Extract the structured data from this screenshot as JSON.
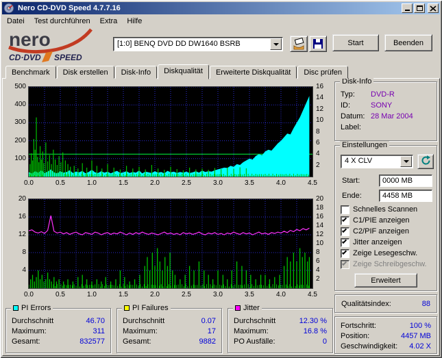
{
  "window": {
    "title": "Nero CD-DVD Speed 4.7.7.16"
  },
  "menu": {
    "items": [
      "Datei",
      "Test durchführen",
      "Extra",
      "Hilfe"
    ]
  },
  "toolbar": {
    "logo": {
      "line1": "nero",
      "line2a": "CD·DVD",
      "line2b": "SPEED"
    },
    "drive": "[1:0]  BENQ DVD DD DW1640 BSRB",
    "start_label": "Start",
    "quit_label": "Beenden"
  },
  "tabs": {
    "items": [
      "Benchmark",
      "Disk erstellen",
      "Disk-Info",
      "Diskqualität",
      "Erweiterte Diskqualität",
      "Disc prüfen"
    ],
    "active_index": 3
  },
  "disk_info": {
    "title": "Disk-Info",
    "rows": [
      {
        "label": "Typ:",
        "value": "DVD-R"
      },
      {
        "label": "ID:",
        "value": "SONY"
      },
      {
        "label": "Datum:",
        "value": "28 Mar 2004"
      },
      {
        "label": "Label:",
        "value": ""
      }
    ]
  },
  "settings": {
    "title": "Einstellungen",
    "speed": "4 X CLV",
    "start_label": "Start:",
    "start_value": "0000 MB",
    "end_label": "Ende:",
    "end_value": "4458 MB",
    "checkboxes": [
      {
        "label": "Schnelles Scannen",
        "checked": false,
        "enabled": true
      },
      {
        "label": "C1/PIE anzeigen",
        "checked": true,
        "enabled": true
      },
      {
        "label": "C2/PIF anzeigen",
        "checked": true,
        "enabled": true
      },
      {
        "label": "Jitter anzeigen",
        "checked": true,
        "enabled": true
      },
      {
        "label": "Zeige Lesegeschw.",
        "checked": true,
        "enabled": true
      },
      {
        "label": "Zeige Schreibgeschw.",
        "checked": true,
        "enabled": false
      }
    ],
    "advanced_label": "Erweitert"
  },
  "quality": {
    "label": "Qualitätsindex:",
    "value": "88"
  },
  "progress": {
    "rows": [
      {
        "label": "Fortschritt:",
        "value": "100 %"
      },
      {
        "label": "Position:",
        "value": "4457 MB"
      },
      {
        "label": "Geschwindigkeit:",
        "value": "4.02 X"
      }
    ]
  },
  "stats": [
    {
      "title": "PI Errors",
      "color": "#00ffff",
      "rows": [
        [
          "Durchschnitt",
          "46.70"
        ],
        [
          "Maximum:",
          "311"
        ],
        [
          "Gesamt:",
          "832577"
        ]
      ]
    },
    {
      "title": "PI Failures",
      "color": "#ffff00",
      "rows": [
        [
          "Durchschnitt",
          "0.07"
        ],
        [
          "Maximum:",
          "17"
        ],
        [
          "Gesamt:",
          "9882"
        ]
      ]
    },
    {
      "title": "Jitter",
      "color": "#ff00ff",
      "rows": [
        [
          "Durchschnitt",
          "12.30 %"
        ],
        [
          "Maximum:",
          "16.8 %"
        ],
        [
          "PO Ausfälle:",
          "0"
        ]
      ]
    }
  ],
  "colors": {
    "value_blue": "#0000d8",
    "disk_value_purple": "#7700b0",
    "titlebar_left": "#0a246a",
    "titlebar_right": "#a6caf0",
    "chart_background": "#000000"
  },
  "chart_data": [
    {
      "type": "area",
      "title": "PI Errors",
      "x_unit": "GB",
      "x_max": 4.5,
      "x_ticks": [
        0,
        0.5,
        1,
        1.5,
        2,
        2.5,
        3,
        3.5,
        4,
        4.5
      ],
      "left_ticks": [
        100,
        200,
        300,
        400,
        500
      ],
      "left_max": 500,
      "right_ticks": [
        2,
        4,
        6,
        8,
        10,
        12,
        14,
        16
      ],
      "right_max": 16,
      "grid_color": "#2a2ad0",
      "area_color": "#00ffff",
      "spike_color": "#00c000",
      "speed_color": "#00cc33",
      "speed_line_value": 4,
      "grass_height": 16,
      "pie_area": {
        "x_step": 0.05,
        "values": [
          25,
          18,
          30,
          22,
          35,
          20,
          28,
          40,
          24,
          18,
          30,
          22,
          26,
          35,
          20,
          28,
          24,
          32,
          18,
          26,
          38,
          24,
          20,
          30,
          22,
          28,
          18,
          26,
          32,
          20,
          24,
          30,
          20,
          26,
          22,
          34,
          18,
          28,
          24,
          20,
          30,
          22,
          26,
          18,
          32,
          24,
          28,
          20,
          26,
          22,
          28,
          20,
          24,
          30,
          22,
          34,
          26,
          30,
          28,
          35,
          40,
          45,
          50,
          48,
          60,
          55,
          70,
          65,
          80,
          90,
          100,
          95,
          115,
          125,
          120,
          140,
          150,
          145,
          165,
          185,
          200,
          220,
          240,
          235,
          270,
          300,
          330,
          370,
          410,
          450
        ]
      },
      "spikes": [
        [
          0.02,
          70
        ],
        [
          0.04,
          130
        ],
        [
          0.06,
          90
        ],
        [
          0.08,
          210
        ],
        [
          0.1,
          150
        ],
        [
          0.12,
          330
        ],
        [
          0.14,
          110
        ],
        [
          0.16,
          80
        ],
        [
          0.18,
          170
        ],
        [
          0.2,
          95
        ],
        [
          0.22,
          140
        ],
        [
          0.24,
          75
        ],
        [
          0.27,
          190
        ],
        [
          0.3,
          85
        ],
        [
          0.33,
          120
        ],
        [
          0.36,
          70
        ],
        [
          0.39,
          150
        ],
        [
          0.42,
          95
        ],
        [
          0.45,
          65
        ],
        [
          0.48,
          115
        ],
        [
          0.51,
          80
        ],
        [
          0.54,
          135
        ],
        [
          0.58,
          90
        ],
        [
          0.62,
          70
        ],
        [
          0.66,
          55
        ],
        [
          0.72,
          60
        ],
        [
          0.78,
          45
        ],
        [
          0.85,
          75
        ],
        [
          0.92,
          50
        ],
        [
          1.0,
          90
        ],
        [
          1.08,
          60
        ],
        [
          1.16,
          45
        ],
        [
          1.25,
          70
        ],
        [
          1.35,
          50
        ],
        [
          1.45,
          40
        ],
        [
          1.55,
          60
        ],
        [
          1.65,
          45
        ],
        [
          1.75,
          55
        ],
        [
          1.85,
          40
        ],
        [
          1.95,
          65
        ],
        [
          2.05,
          45
        ],
        [
          2.15,
          38
        ],
        [
          2.25,
          55
        ],
        [
          2.35,
          42
        ],
        [
          2.45,
          35
        ],
        [
          2.55,
          50
        ],
        [
          2.65,
          40
        ],
        [
          2.75,
          45
        ],
        [
          2.85,
          38
        ],
        [
          2.95,
          48
        ],
        [
          3.05,
          42
        ],
        [
          3.15,
          50
        ],
        [
          3.25,
          44
        ],
        [
          3.35,
          52
        ],
        [
          3.45,
          46
        ]
      ]
    },
    {
      "type": "line+bars",
      "title": "PI Failures / Jitter",
      "x_unit": "GB",
      "x_max": 4.5,
      "x_ticks": [
        0,
        0.5,
        1,
        1.5,
        2,
        2.5,
        3,
        3.5,
        4,
        4.5
      ],
      "left_ticks": [
        4,
        8,
        12,
        16,
        20
      ],
      "left_max": 20,
      "right_ticks": [
        2,
        4,
        6,
        8,
        10,
        12,
        14,
        16,
        18,
        20
      ],
      "right_max": 20,
      "grid_color": "#2a2ad0",
      "spike_color": "#00c000",
      "jitter_color": "#ff30ff",
      "grass_height": 0.9,
      "jitter": {
        "x_step": 0.05,
        "values": [
          12.9,
          13.1,
          12.6,
          12.4,
          12.7,
          12.3,
          13.0,
          16.3,
          12.8,
          12.4,
          12.6,
          12.2,
          12.5,
          12.1,
          12.4,
          12.6,
          12.2,
          12.0,
          12.5,
          12.3,
          12.1,
          12.6,
          12.4,
          12.0,
          12.3,
          12.5,
          12.1,
          12.4,
          12.2,
          12.6,
          12.3,
          12.0,
          12.4,
          12.1,
          12.5,
          12.2,
          12.6,
          12.3,
          12.1,
          12.4,
          12.2,
          12.0,
          12.3,
          12.6,
          12.2,
          12.4,
          12.1,
          12.3,
          12.0,
          12.5,
          12.2,
          12.4,
          12.1,
          12.3,
          12.6,
          12.2,
          12.0,
          12.4,
          12.2,
          12.5,
          12.1,
          12.3,
          12.0,
          12.4,
          12.2,
          12.6,
          12.3,
          12.1,
          12.5,
          12.2,
          12.4,
          12.0,
          12.3,
          12.6,
          12.2,
          12.4,
          12.1,
          12.5,
          12.3,
          12.6,
          12.4,
          12.8,
          12.5,
          13.0,
          12.7,
          13.2,
          12.9,
          13.4,
          13.1,
          13.5
        ]
      },
      "pif_spikes": [
        [
          0.03,
          2
        ],
        [
          0.06,
          3
        ],
        [
          0.09,
          1.5
        ],
        [
          0.12,
          2.5
        ],
        [
          0.15,
          4
        ],
        [
          0.18,
          2
        ],
        [
          0.21,
          3
        ],
        [
          0.24,
          1.5
        ],
        [
          0.27,
          2
        ],
        [
          0.3,
          3.5
        ],
        [
          0.33,
          2
        ],
        [
          0.36,
          1.5
        ],
        [
          0.4,
          2.5
        ],
        [
          0.44,
          1.5
        ],
        [
          0.48,
          2
        ],
        [
          0.55,
          1.5
        ],
        [
          0.62,
          2
        ],
        [
          0.7,
          1.5
        ],
        [
          0.78,
          2.5
        ],
        [
          0.85,
          3
        ],
        [
          0.92,
          2
        ],
        [
          1.0,
          1.5
        ],
        [
          1.08,
          2
        ],
        [
          1.15,
          1.5
        ],
        [
          1.22,
          2.5
        ],
        [
          1.3,
          1.5
        ],
        [
          1.38,
          2
        ],
        [
          1.45,
          4
        ],
        [
          1.52,
          2.5
        ],
        [
          1.6,
          1.5
        ],
        [
          1.68,
          2
        ],
        [
          1.76,
          3
        ],
        [
          1.84,
          5
        ],
        [
          1.88,
          7
        ],
        [
          1.92,
          4
        ],
        [
          1.96,
          8
        ],
        [
          2.0,
          5
        ],
        [
          2.04,
          9
        ],
        [
          2.08,
          6
        ],
        [
          2.12,
          4
        ],
        [
          2.16,
          7
        ],
        [
          2.2,
          5
        ],
        [
          2.24,
          8
        ],
        [
          2.28,
          4
        ],
        [
          2.32,
          3
        ],
        [
          2.4,
          2
        ],
        [
          2.48,
          3
        ],
        [
          2.55,
          5
        ],
        [
          2.62,
          4
        ],
        [
          2.7,
          6
        ],
        [
          2.78,
          4
        ],
        [
          2.85,
          3
        ],
        [
          2.92,
          2
        ],
        [
          3.0,
          4
        ],
        [
          3.08,
          3
        ],
        [
          3.15,
          2
        ],
        [
          3.22,
          4
        ],
        [
          3.3,
          6
        ],
        [
          3.38,
          5
        ],
        [
          3.45,
          4
        ],
        [
          3.52,
          3
        ],
        [
          3.6,
          2
        ],
        [
          3.68,
          3
        ],
        [
          3.75,
          3
        ],
        [
          3.82,
          2
        ],
        [
          3.9,
          2.5
        ],
        [
          3.98,
          3
        ],
        [
          4.05,
          5
        ],
        [
          4.1,
          7
        ],
        [
          4.15,
          6
        ],
        [
          4.2,
          8
        ],
        [
          4.25,
          6
        ],
        [
          4.3,
          9
        ],
        [
          4.34,
          7
        ],
        [
          4.38,
          8
        ],
        [
          4.42,
          6
        ],
        [
          4.45,
          7
        ]
      ]
    }
  ]
}
